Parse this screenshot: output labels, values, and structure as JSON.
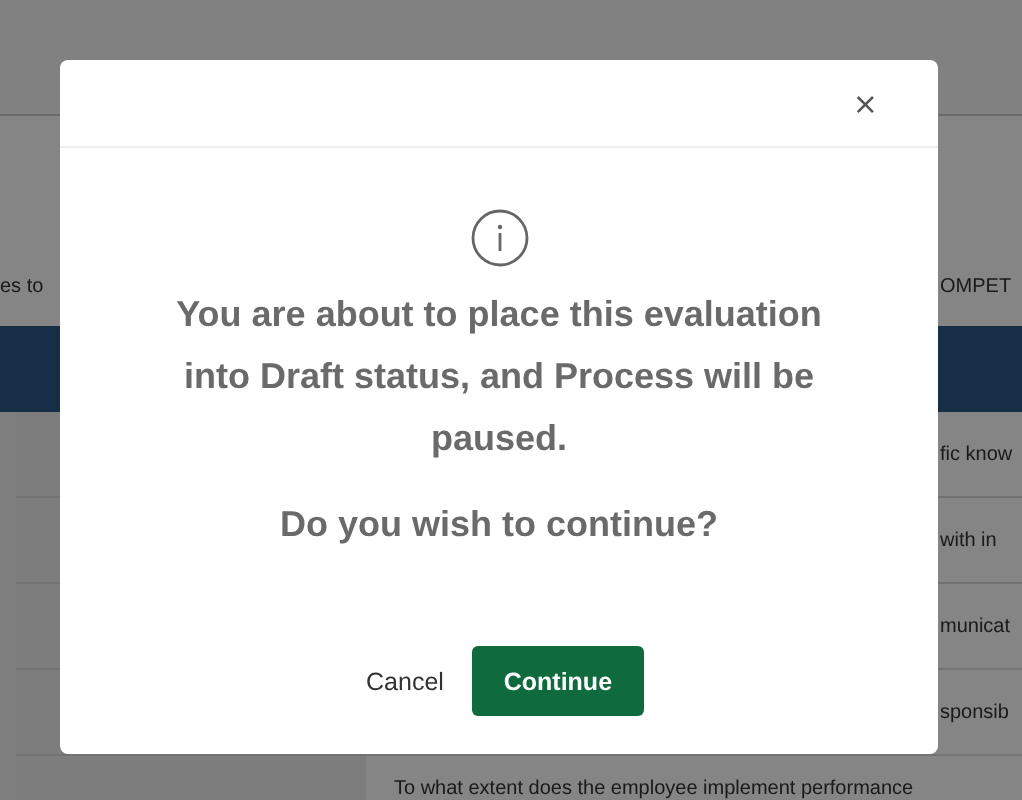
{
  "background": {
    "heading_fragment_left": "es to",
    "heading_fragment_right": "OMPET",
    "row_fragments": [
      "fic know",
      "with in",
      "municat",
      "sponsib"
    ],
    "question": "To what extent does the employee implement performance"
  },
  "dialog": {
    "close": "×",
    "message": "You are about to place this evaluation into Draft status, and Process will be paused.",
    "question": "Do you wish to continue?",
    "buttons": [
      {
        "label": "Cancel",
        "kind": "secondary"
      },
      {
        "label": "Continue",
        "kind": "primary"
      }
    ]
  }
}
